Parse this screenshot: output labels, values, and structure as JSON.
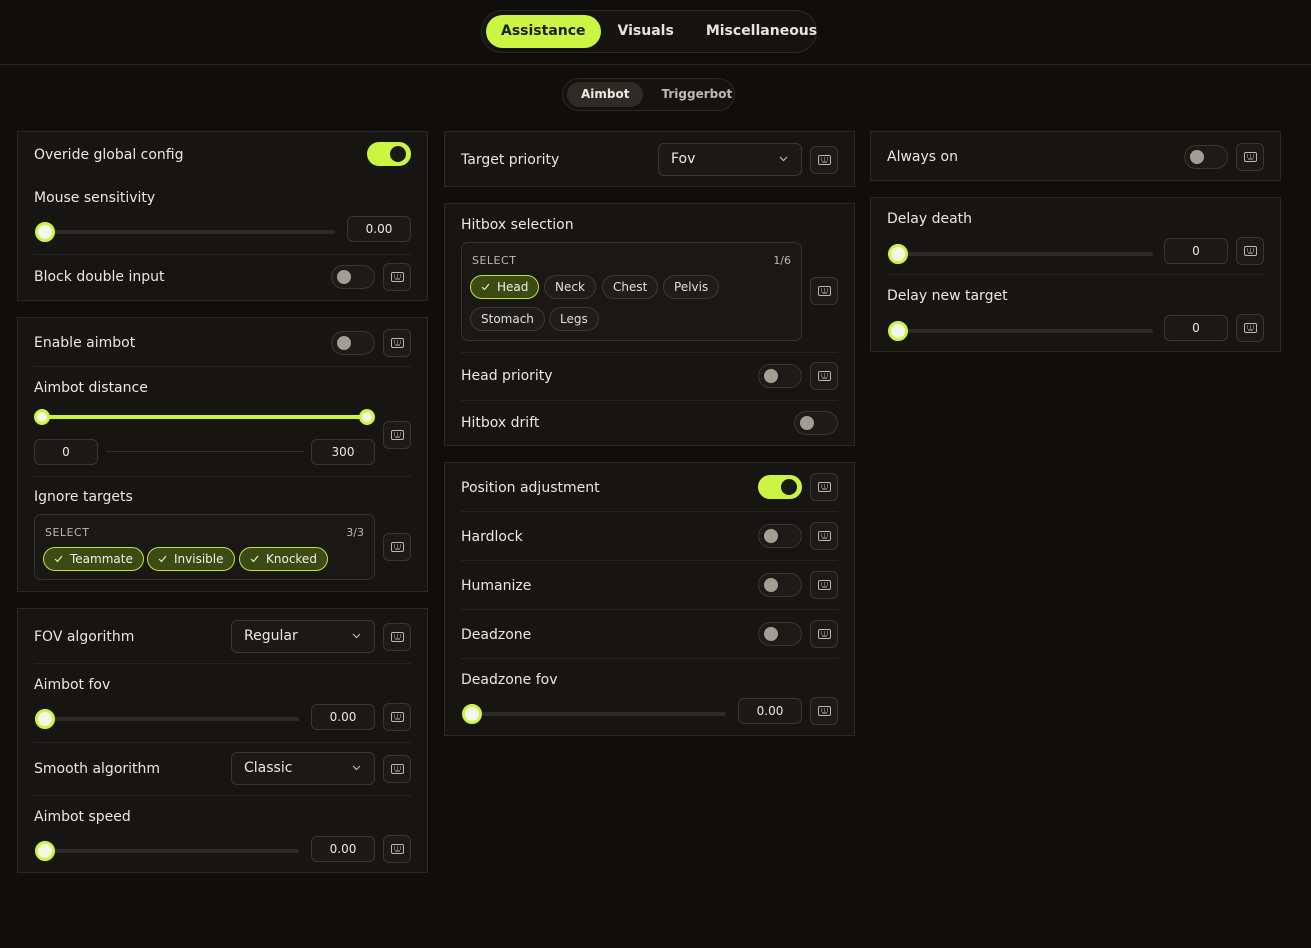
{
  "main_tabs": [
    {
      "label": "Assistance",
      "active": true
    },
    {
      "label": "Visuals",
      "active": false
    },
    {
      "label": "Miscellaneous",
      "active": false
    }
  ],
  "sub_tabs": [
    {
      "label": "Aimbot",
      "active": true
    },
    {
      "label": "Triggerbot",
      "active": false
    }
  ],
  "colors": {
    "accent": "#cbf542",
    "background": "#0f0e0c",
    "panel": "#171512"
  },
  "icons": {
    "keybind": "keyboard-icon",
    "dropdown": "chevron-down-icon",
    "chip_selected": "check-icon"
  },
  "global": {
    "override_label": "Overide global config",
    "override_on": true,
    "mouse_sens_label": "Mouse sensitivity",
    "mouse_sens_value": "0.00",
    "block_double_label": "Block double input",
    "block_double_on": false
  },
  "aimbot": {
    "enable_label": "Enable aimbot",
    "enable_on": false,
    "distance_label": "Aimbot distance",
    "distance_min": "0",
    "distance_max": "300",
    "ignore_label": "Ignore targets",
    "ignore_select_header": "SELECT",
    "ignore_count": "3/3",
    "ignore_chips": [
      "Teammate",
      "Invisible",
      "Knocked"
    ]
  },
  "fov": {
    "algorithm_label": "FOV algorithm",
    "algorithm_value": "Regular",
    "fov_label": "Aimbot fov",
    "fov_value": "0.00",
    "smooth_label": "Smooth algorithm",
    "smooth_value": "Classic",
    "speed_label": "Aimbot speed",
    "speed_value": "0.00"
  },
  "target": {
    "priority_label": "Target priority",
    "priority_value": "Fov"
  },
  "hitbox": {
    "selection_label": "Hitbox selection",
    "select_header": "SELECT",
    "count": "1/6",
    "chips": [
      {
        "label": "Head",
        "selected": true
      },
      {
        "label": "Neck",
        "selected": false
      },
      {
        "label": "Chest",
        "selected": false
      },
      {
        "label": "Pelvis",
        "selected": false
      },
      {
        "label": "Stomach",
        "selected": false
      },
      {
        "label": "Legs",
        "selected": false
      }
    ],
    "head_priority_label": "Head priority",
    "head_priority_on": false,
    "drift_label": "Hitbox drift",
    "drift_on": false
  },
  "position": {
    "adjust_label": "Position adjustment",
    "adjust_on": true,
    "hardlock_label": "Hardlock",
    "hardlock_on": false,
    "humanize_label": "Humanize",
    "humanize_on": false,
    "deadzone_label": "Deadzone",
    "deadzone_on": false,
    "deadzone_fov_label": "Deadzone fov",
    "deadzone_fov_value": "0.00"
  },
  "trigger": {
    "always_on_label": "Always on",
    "always_on": false
  },
  "delay": {
    "death_label": "Delay death",
    "death_value": "0",
    "new_target_label": "Delay new target",
    "new_target_value": "0"
  }
}
